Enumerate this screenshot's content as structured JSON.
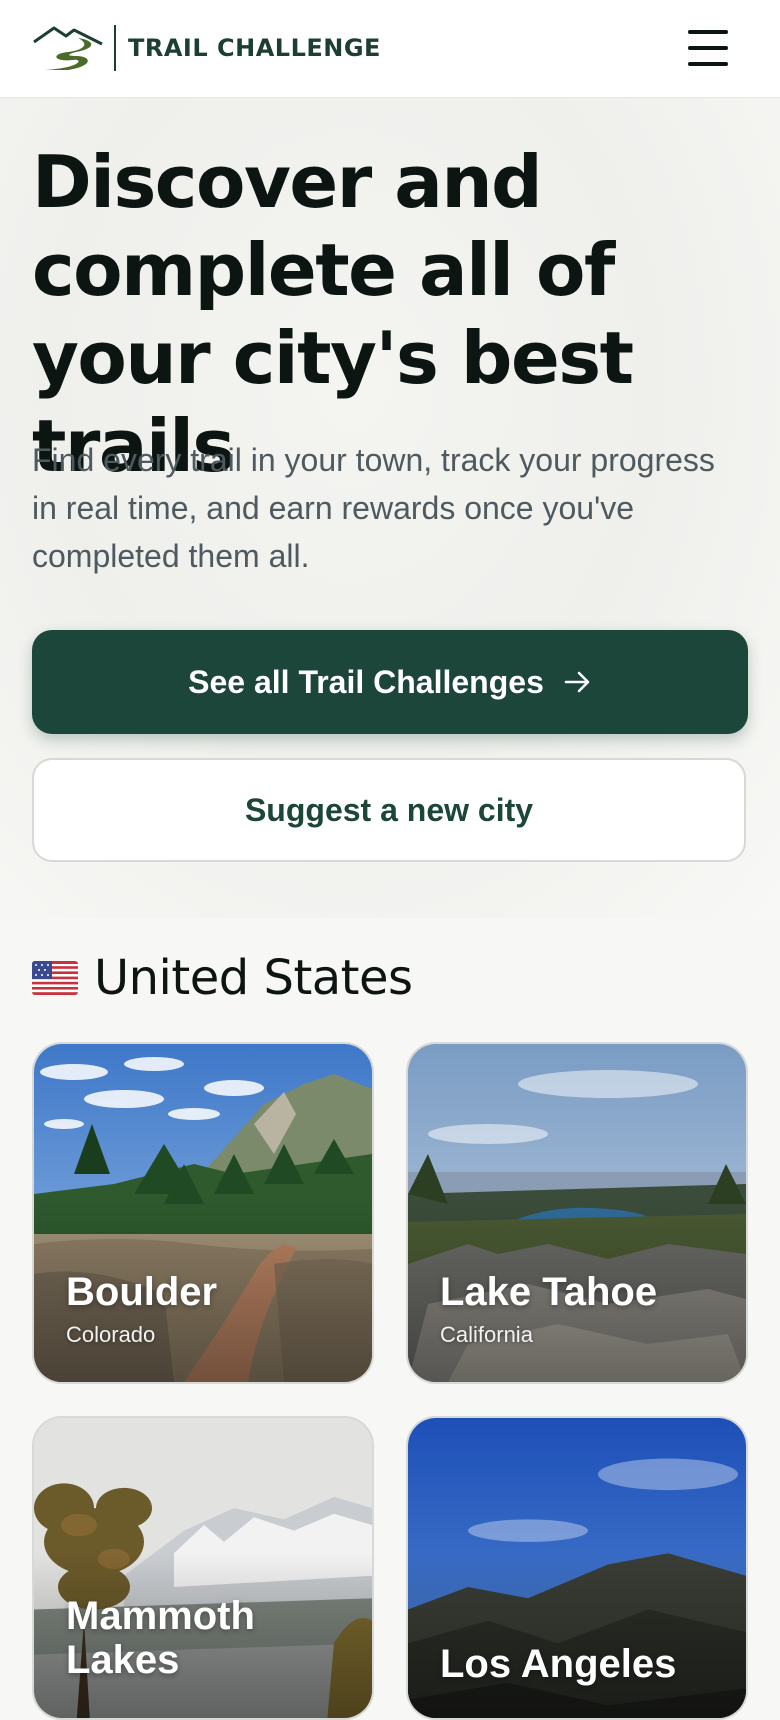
{
  "header": {
    "brand": "TRAIL CHALLENGE",
    "logo_icon": "mountain-trail-logo",
    "menu_icon": "hamburger-menu-icon"
  },
  "hero": {
    "title": "Discover and complete all of your city's best trails",
    "subtitle": "Find every trail in your town, track your progress in real time, and earn rewards once you've completed them all.",
    "primary_button": "See all Trail Challenges",
    "secondary_button": "Suggest a new city"
  },
  "section": {
    "flag": "us-flag",
    "title": "United States"
  },
  "cities": [
    {
      "name": "Boulder",
      "state": "Colorado"
    },
    {
      "name": "Lake Tahoe",
      "state": "California"
    },
    {
      "name": "Mammoth Lakes",
      "state": ""
    },
    {
      "name": "Los Angeles",
      "state": ""
    }
  ],
  "colors": {
    "brand_green": "#1b4639",
    "text_dark": "#0c1512",
    "text_muted": "#4e5a5f"
  }
}
